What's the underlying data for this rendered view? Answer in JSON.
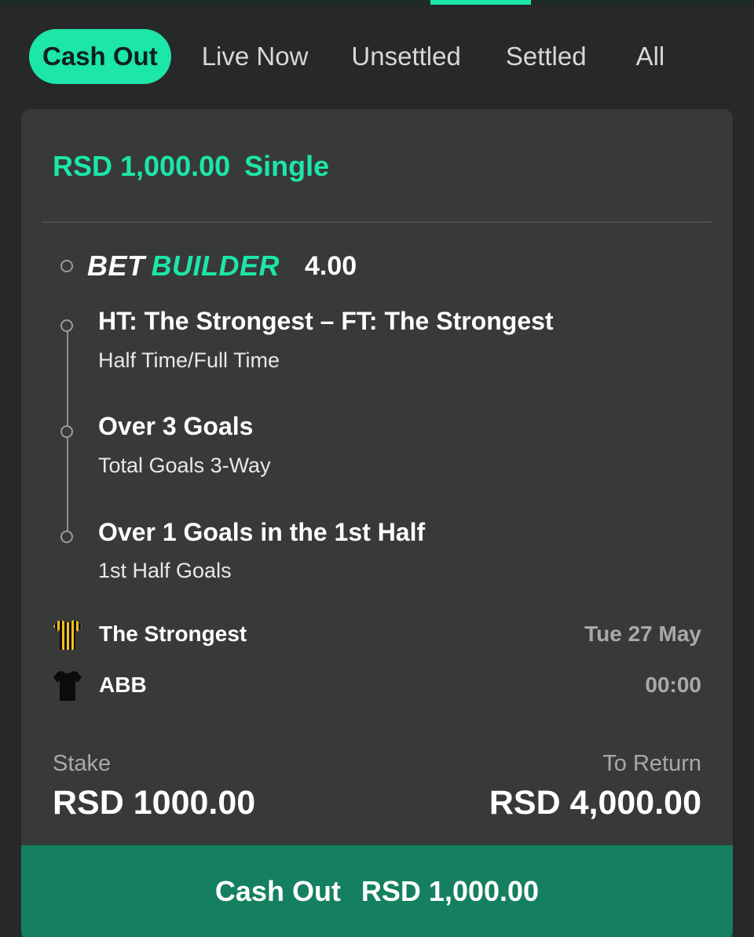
{
  "tabs": [
    {
      "label": "Cash Out",
      "selected": true
    },
    {
      "label": "Live Now",
      "selected": false
    },
    {
      "label": "Unsettled",
      "selected": false
    },
    {
      "label": "Settled",
      "selected": false
    },
    {
      "label": "All",
      "selected": false
    }
  ],
  "bet": {
    "amount": "RSD 1,000.00",
    "type": "Single",
    "builder_label_1": "BET",
    "builder_label_2": "BUILDER",
    "odds": "4.00",
    "selections": [
      {
        "name": "HT: The Strongest – FT: The Strongest",
        "market": "Half Time/Full Time"
      },
      {
        "name": "Over 3 Goals",
        "market": "Total Goals 3-Way"
      },
      {
        "name": "Over 1 Goals in the 1st Half",
        "market": "1st Half Goals"
      }
    ],
    "home_team": {
      "name": "The Strongest",
      "kit_icon": "striped-kit-icon",
      "meta": "Tue 27 May"
    },
    "away_team": {
      "name": "ABB",
      "kit_icon": "black-kit-icon",
      "meta": "00:00"
    },
    "stake_label": "Stake",
    "stake_value": "RSD 1000.00",
    "return_label": "To Return",
    "return_value": "RSD 4,000.00"
  },
  "cashout": {
    "label": "Cash Out",
    "amount": "RSD 1,000.00"
  },
  "colors": {
    "accent": "#1ce6a8",
    "background": "#272828",
    "card": "#373a39",
    "cashout_button": "#14805f"
  }
}
